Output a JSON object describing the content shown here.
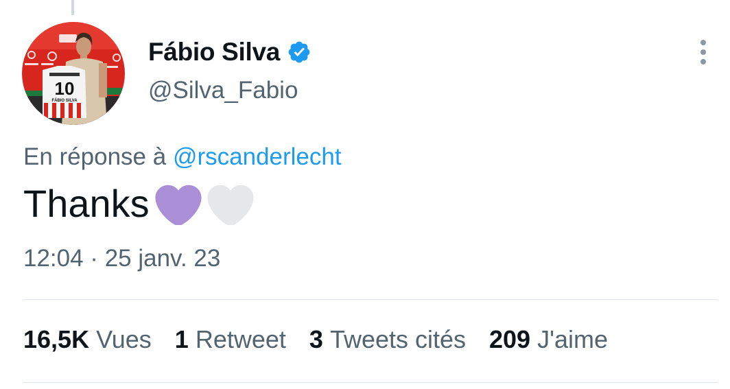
{
  "tweet": {
    "author": {
      "display_name": "Fábio Silva",
      "handle": "@Silva_Fabio",
      "verified": true,
      "avatar_icon": "profile-photo",
      "avatar_shirt_number": "10",
      "avatar_shirt_name": "FÁBIO SILVA"
    },
    "reply_prefix": "En réponse à",
    "reply_mention": "@rscanderlecht",
    "text": "Thanks",
    "emojis": [
      {
        "name": "purple-heart-icon",
        "color": "#aa8ed6"
      },
      {
        "name": "white-heart-icon",
        "color": "#e6e7e8"
      }
    ],
    "timestamp": "12:04 · 25 janv. 23",
    "stats": {
      "views_count": "16,5K",
      "views_label": "Vues",
      "retweets_count": "1",
      "retweets_label": "Retweet",
      "quotes_count": "3",
      "quotes_label": "Tweets cités",
      "likes_count": "209",
      "likes_label": "J'aime"
    }
  },
  "colors": {
    "text_primary": "#0f1419",
    "text_secondary": "#536471",
    "link": "#1d9bf0",
    "verified": "#1d9bf0",
    "divider": "#e1e8ed"
  }
}
